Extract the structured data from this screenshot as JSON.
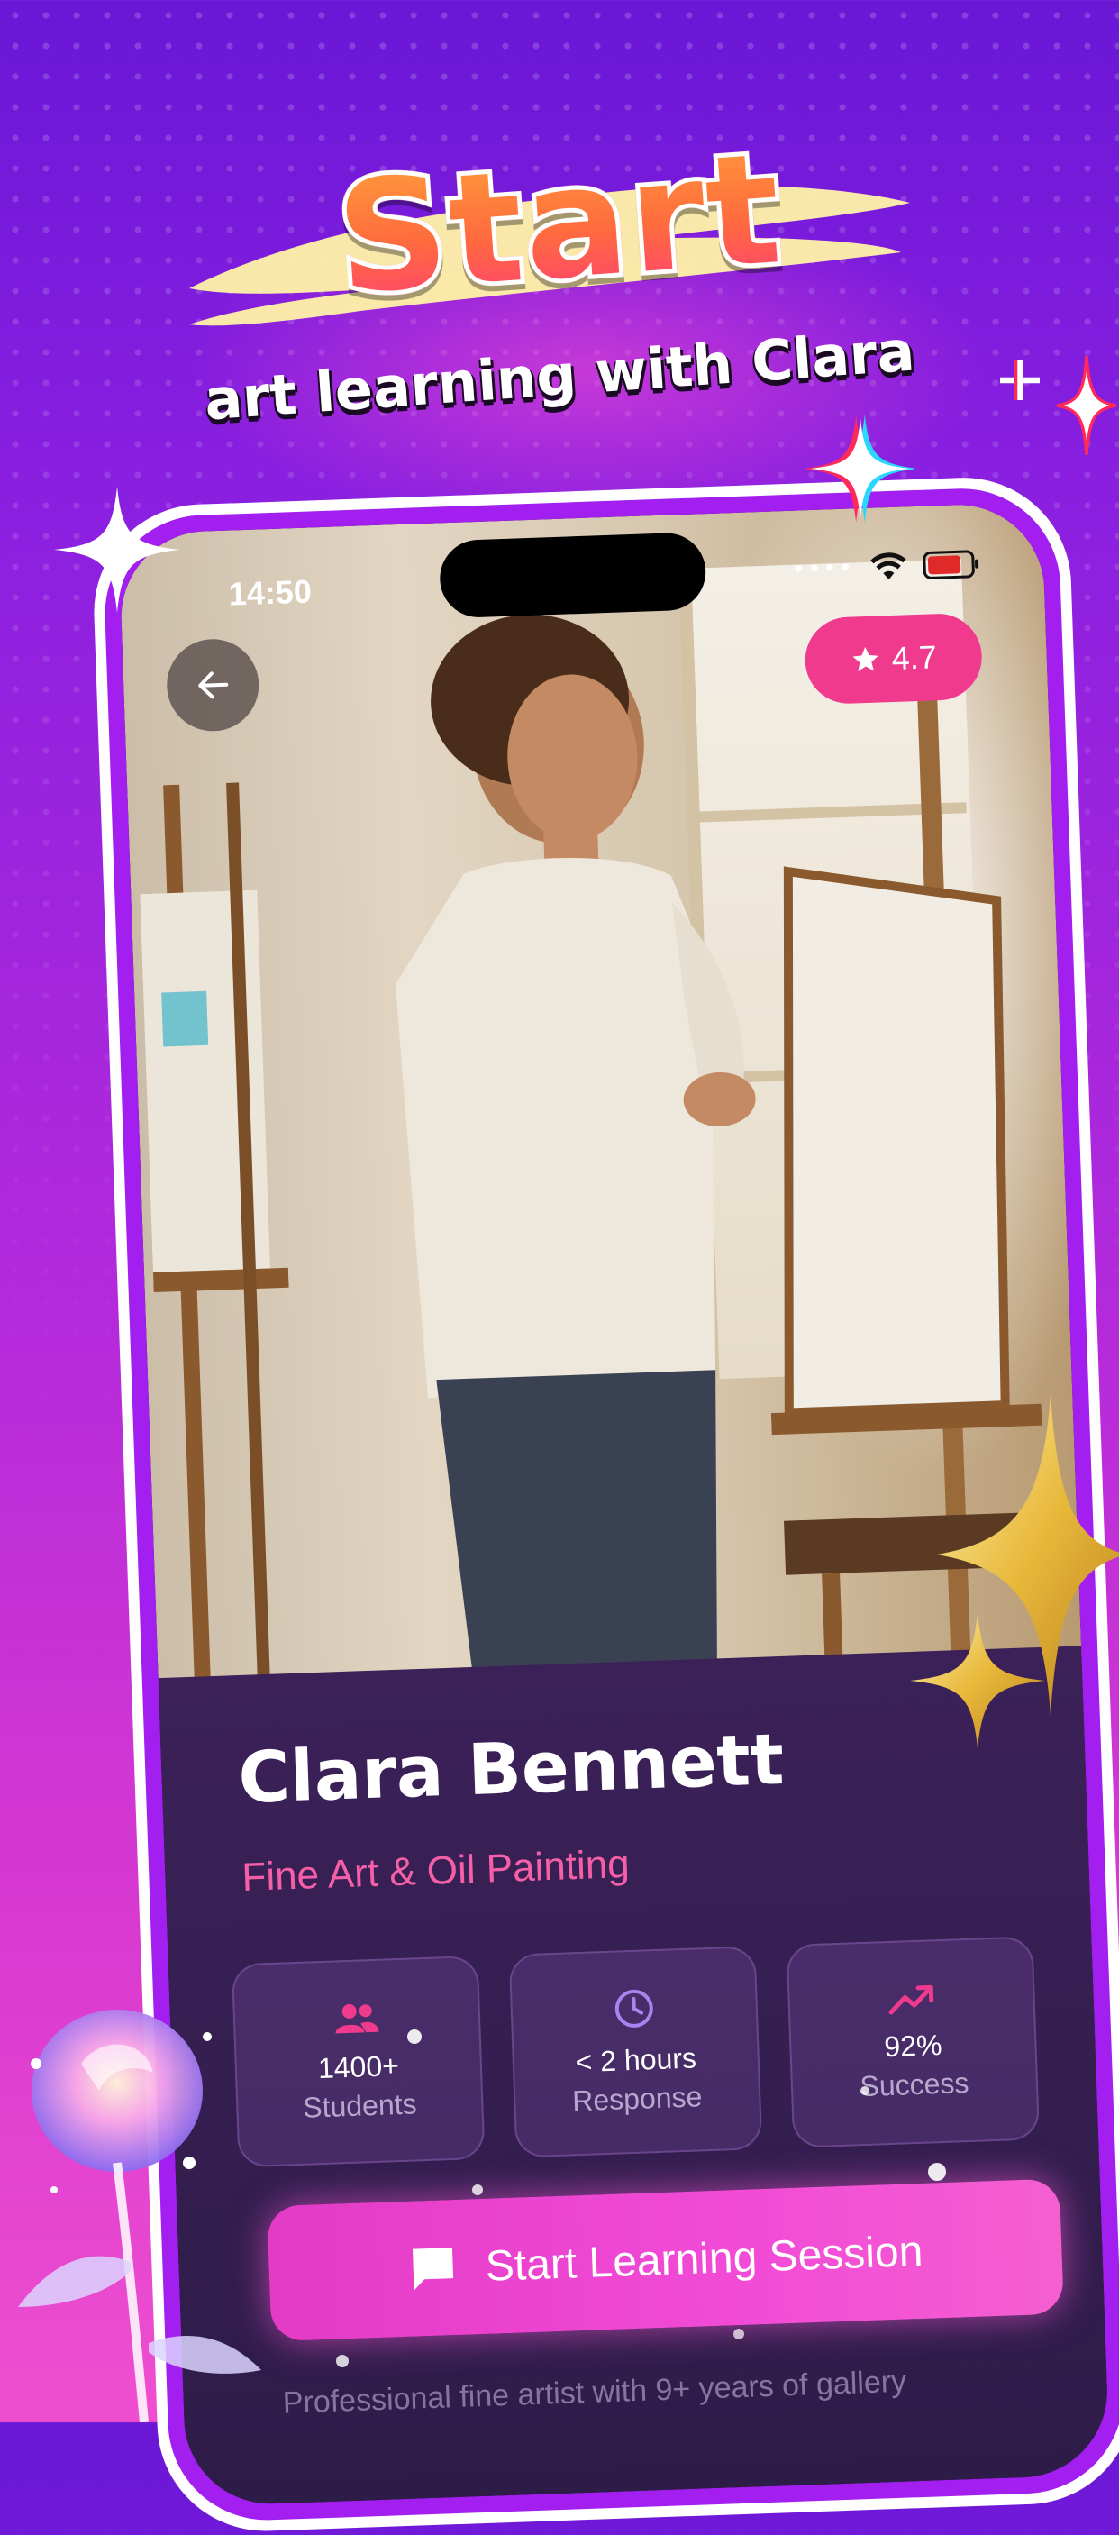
{
  "promo": {
    "headline": "Start",
    "subheadline": "art learning with Clara"
  },
  "status_bar": {
    "time": "14:50"
  },
  "profile": {
    "rating": "4.7",
    "name": "Clara Bennett",
    "specialty": "Fine Art & Oil Painting",
    "stats": [
      {
        "icon": "people-icon",
        "value": "1400+",
        "label": "Students",
        "color": "#f03a8e"
      },
      {
        "icon": "clock-icon",
        "value": "< 2 hours",
        "label": "Response",
        "color": "#a884f0"
      },
      {
        "icon": "trend-up-icon",
        "value": "92%",
        "label": "Success",
        "color": "#f03a8e"
      }
    ],
    "cta_label": "Start Learning Session",
    "bio": "Professional fine artist with 9+ years of gallery"
  },
  "colors": {
    "accent": "#f03a8e",
    "background": "#a21ff0",
    "card": "#2e1c48"
  }
}
